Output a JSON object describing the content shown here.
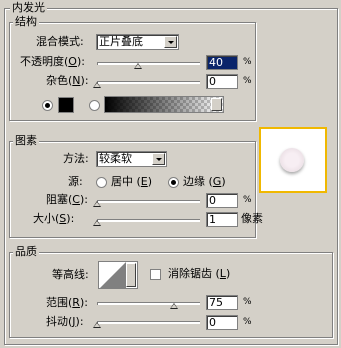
{
  "structure": {
    "outer_title": "内发光",
    "title": "结构",
    "blend_mode_label": "混合模式:",
    "blend_mode_value": "正片叠底",
    "opacity_label": "不透明度",
    "opacity_key": "O",
    "opacity_value": "40",
    "opacity_unit": "%",
    "opacity_level": 40,
    "noise_label": "杂色",
    "noise_key": "N",
    "noise_value": "0",
    "noise_unit": "%",
    "noise_level": 0,
    "color_swatch": "#000000"
  },
  "elements": {
    "title": "图素",
    "method_label": "方法:",
    "method_value": "较柔软",
    "source_label": "源:",
    "center_label": "居中",
    "center_key": "E",
    "edge_label": "边缘",
    "edge_key": "G",
    "choke_label": "阻塞",
    "choke_key": "C",
    "choke_value": "0",
    "choke_unit": "%",
    "choke_level": 0,
    "size_label": "大小",
    "size_key": "S",
    "size_value": "1",
    "size_unit": "像素",
    "size_level": 1
  },
  "quality": {
    "title": "品质",
    "contour_label": "等高线:",
    "antialias_label": "消除锯齿",
    "antialias_key": "L",
    "range_label": "范围",
    "range_key": "R",
    "range_value": "75",
    "range_unit": "%",
    "range_level": 75,
    "jitter_label": "抖动",
    "jitter_key": "J",
    "jitter_value": "0",
    "jitter_unit": "%",
    "jitter_level": 0
  },
  "colors": {
    "panel_bg": "#d4d0c8",
    "preview_border": "#f0b800",
    "selection": "#0a246a"
  }
}
